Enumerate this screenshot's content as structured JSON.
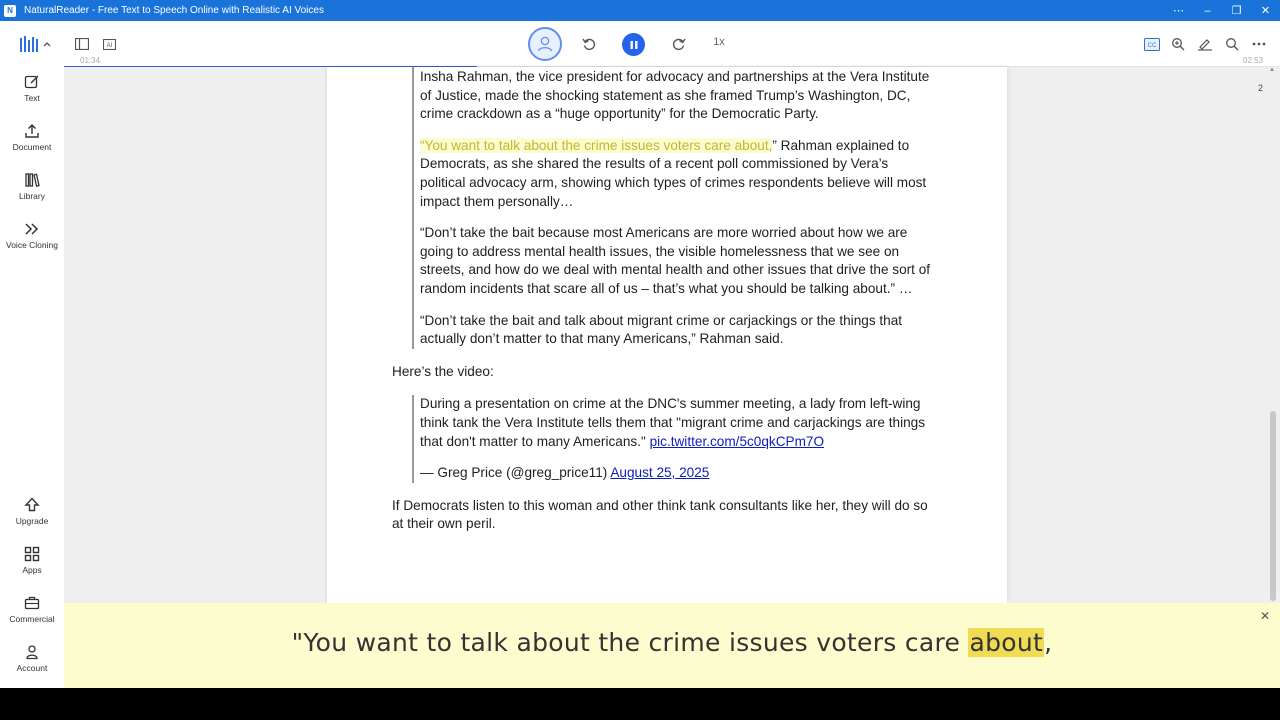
{
  "window": {
    "title": "NaturalReader - Free Text to Speech Online with Realistic AI Voices",
    "controls": [
      "⋯",
      "–",
      "❐",
      "✕"
    ]
  },
  "toolbar": {
    "elapsed": "01:34",
    "total": "02:53",
    "speed": "1x",
    "progress": 0.34,
    "accent": "#2563eb"
  },
  "sidebar": {
    "top_items": [
      {
        "label": "Text",
        "icon": "edit-icon"
      },
      {
        "label": "Document",
        "icon": "upload-icon"
      },
      {
        "label": "Library",
        "icon": "library-icon"
      },
      {
        "label": "Voice Cloning",
        "icon": "voice-cloning-icon"
      }
    ],
    "bottom_items": [
      {
        "label": "Upgrade",
        "icon": "upgrade-icon"
      },
      {
        "label": "Apps",
        "icon": "apps-icon"
      },
      {
        "label": "Commercial",
        "icon": "briefcase-icon"
      },
      {
        "label": "Account",
        "icon": "account-icon"
      }
    ]
  },
  "document": {
    "page_number": "2",
    "para1": "Insha Rahman, the vice president for advocacy and partnerships at the Vera Institute of Justice, made the shocking statement as she framed Trump’s Washington, DC, crime crackdown as a “huge opportunity” for the Democratic Party.",
    "para2_highlight": "“You want to talk about the crime issues voters care about,",
    "para2_rest": "” Rahman explained to Democrats, as she shared the results of a recent poll commissioned by Vera’s political advocacy arm, showing which types of crimes respondents believe will most impact them personally…",
    "para3": "“Don’t take the bait because most Americans are more worried about how we are going to address mental health issues, the visible homelessness that we see on streets, and how do we deal with mental health and other issues that drive the sort of random incidents that scare all of us – that’s what you should be talking about.” …",
    "para4": "“Don’t take the bait and talk about migrant crime or carjackings or the things that actually don’t matter to that many Americans,” Rahman said.",
    "video_intro": "Here’s the video:",
    "tweet_text": "During a presentation on crime at the DNC's summer meeting, a lady from left-wing think tank the Vera Institute tells them that \"migrant crime and carjackings are things that don't matter to many Americans.\"",
    "tweet_link": "pic.twitter.com/5c0qkCPm7O",
    "tweet_author": "— Greg Price (@greg_price11)",
    "tweet_date": "August 25, 2025",
    "closing": "If Democrats listen to this woman and other think tank consultants like her, they will do so at their own peril."
  },
  "caption": {
    "before": "\"You want to talk about the crime issues voters care ",
    "current_word": "about",
    "after": ","
  }
}
